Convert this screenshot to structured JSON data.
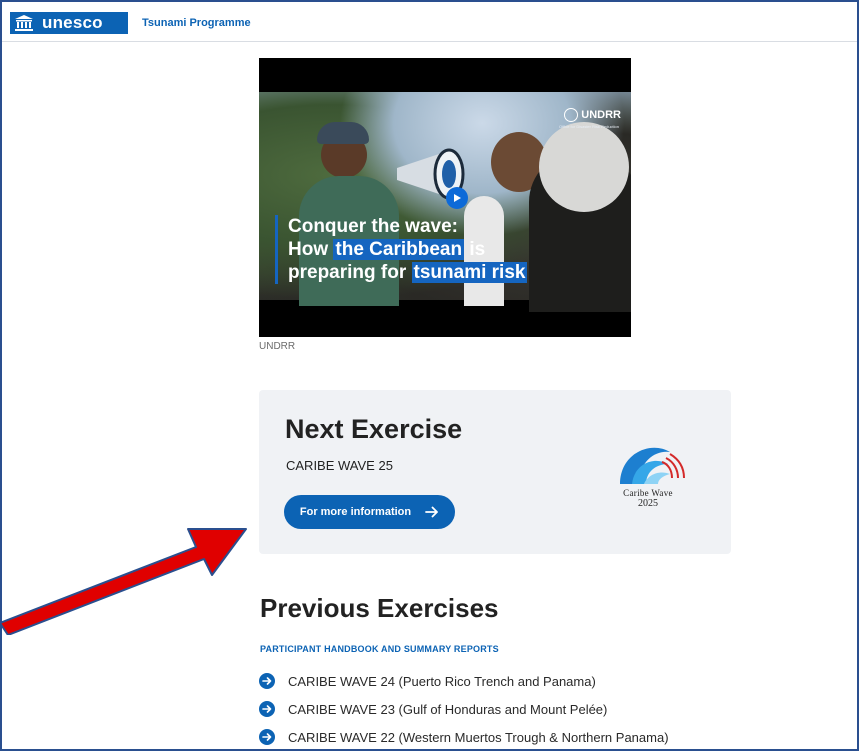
{
  "header": {
    "logo_text": "unesco",
    "programme_label": "Tsunami Programme"
  },
  "video": {
    "title_line1": "Conquer the wave:",
    "title_line2_a": "How ",
    "title_line2_b": "the Caribbean",
    "title_line2_c": " is",
    "title_line3_a": "preparing for ",
    "title_line3_b": "tsunami risk",
    "watermark": "UNDRR",
    "watermark_sub": "Office for Disaster Risk Reduction",
    "caption": "UNDRR",
    "play_icon": "play-icon"
  },
  "next_exercise": {
    "heading": "Next Exercise",
    "name": "CARIBE WAVE 25",
    "button_label": "For more information",
    "badge_line1": "Caribe Wave",
    "badge_line2": "2025"
  },
  "previous_exercises": {
    "heading": "Previous Exercises",
    "section_label": "PARTICIPANT HANDBOOK AND SUMMARY REPORTS",
    "items": [
      "CARIBE WAVE 24 (Puerto Rico Trench and Panama)",
      "CARIBE WAVE 23 (Gulf of Honduras and Mount Pelée)",
      "CARIBE WAVE 22 (Western Muertos Trough & Northern Panama)"
    ]
  },
  "colors": {
    "brand_blue": "#0c63b4",
    "annotation_arrow": "#e00000",
    "card_bg": "#f0f2f5"
  }
}
